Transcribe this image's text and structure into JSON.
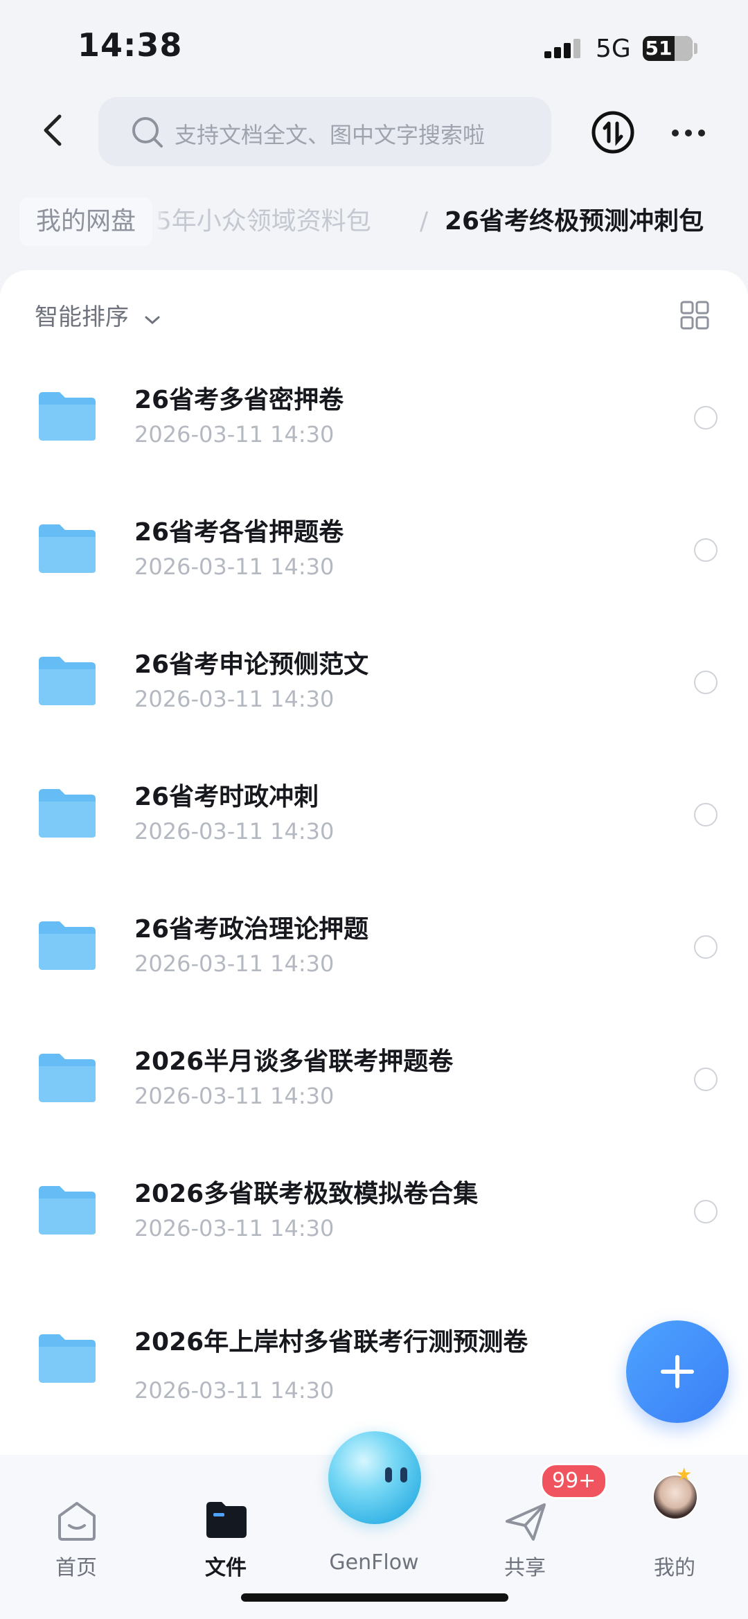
{
  "status_bar": {
    "time": "14:38",
    "network": "5G",
    "battery": "51"
  },
  "header": {
    "search_placeholder": "支持文档全文、图中文字搜索啦"
  },
  "breadcrumb": {
    "root": "我的网盘",
    "middle": "25年小众领域资料包",
    "separator": "/",
    "current": "26省考终极预测冲刺包"
  },
  "toolbar": {
    "sort_label": "智能排序"
  },
  "files": [
    {
      "name": "26省考多省密押卷",
      "date": "2026-03-11 14:30"
    },
    {
      "name": "26省考各省押题卷",
      "date": "2026-03-11 14:30"
    },
    {
      "name": "26省考申论预侧范文",
      "date": "2026-03-11 14:30"
    },
    {
      "name": "26省考时政冲刺",
      "date": "2026-03-11 14:30"
    },
    {
      "name": "26省考政治理论押题",
      "date": "2026-03-11 14:30"
    },
    {
      "name": "2026半月谈多省联考押题卷",
      "date": "2026-03-11 14:30"
    },
    {
      "name": "2026多省联考极致模拟卷合集",
      "date": "2026-03-11 14:30"
    },
    {
      "name": "2026年上岸村多省联考行测预测卷",
      "date": "2026-03-11 14:30"
    }
  ],
  "nav": {
    "home": "首页",
    "files": "文件",
    "genflow": "GenFlow",
    "share": "共享",
    "share_badge": "99+",
    "me": "我的"
  },
  "colors": {
    "accent": "#3a7ff6",
    "folder": "#5cb8f6",
    "badge": "#f0545e"
  },
  "icons": [
    "back-arrow-icon",
    "search-icon",
    "transfer-icon",
    "more-icon",
    "chevron-down-icon",
    "grid-view-icon",
    "folder-icon",
    "plus-icon",
    "home-icon",
    "folder-nav-icon",
    "genflow-icon",
    "share-icon",
    "avatar"
  ]
}
